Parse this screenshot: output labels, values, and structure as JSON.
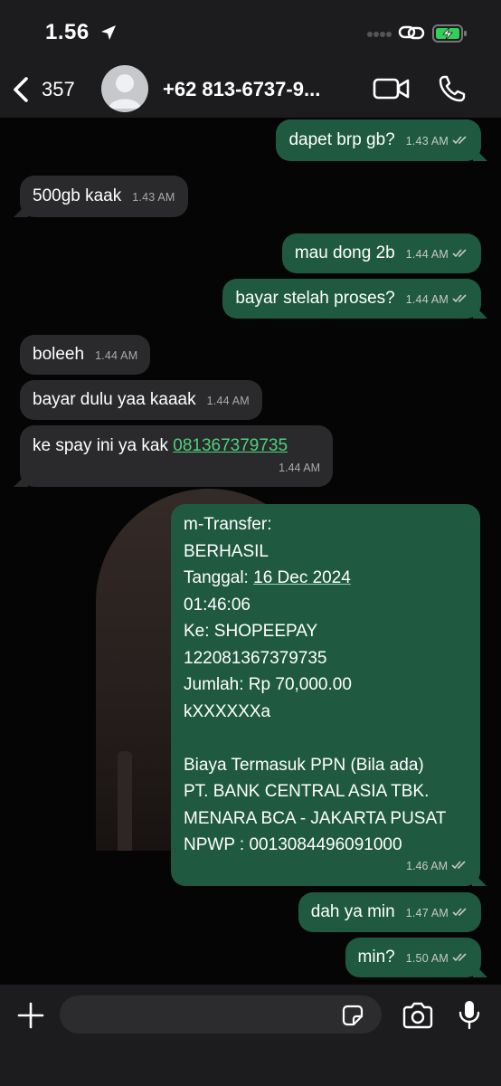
{
  "status": {
    "time": "1.56",
    "icons": [
      "location-arrow-icon",
      "signal-dots-icon",
      "link-icon",
      "battery-charging-icon"
    ],
    "battery_color": "#30d158"
  },
  "header": {
    "back_count": "357",
    "contact": "+62 813-6737-9...",
    "icons": [
      "chevron-left-icon",
      "avatar-placeholder",
      "video-call-icon",
      "phone-icon"
    ]
  },
  "messages": [
    {
      "dir": "out",
      "text": "dapet brp gb?",
      "time": "1.43 AM"
    },
    {
      "dir": "in",
      "text": "500gb kaak",
      "time": "1.43 AM"
    },
    {
      "dir": "out",
      "text": "mau dong 2b",
      "time": "1.44 AM"
    },
    {
      "dir": "out",
      "text": "bayar stelah proses?",
      "time": "1.44 AM"
    },
    {
      "dir": "in",
      "text": "boleeh",
      "time": "1.44 AM"
    },
    {
      "dir": "in",
      "text": "bayar dulu yaa kaaak",
      "time": "1.44 AM"
    },
    {
      "dir": "in",
      "text": "ke spay ini ya kak ",
      "link": "081367379735",
      "time": "1.44 AM"
    },
    {
      "dir": "out",
      "lines": [
        "m-Transfer:",
        "BERHASIL",
        "Tanggal: ",
        "01:46:06",
        "Ke: SHOPEEPAY",
        "122081367379735",
        "Jumlah: Rp 70,000.00",
        "kXXXXXXa",
        "",
        "Biaya Termasuk PPN (Bila ada)",
        "PT. BANK CENTRAL ASIA TBK.",
        "MENARA BCA - JAKARTA PUSAT",
        "NPWP : 0013084496091000"
      ],
      "date_value": "16 Dec 2024",
      "time": "1.46 AM"
    },
    {
      "dir": "out",
      "text": "dah ya min",
      "time": "1.47 AM"
    },
    {
      "dir": "out",
      "text": "min?",
      "time": "1.50 AM"
    }
  ],
  "composer": {
    "placeholder": "",
    "icons": [
      "plus-icon",
      "sticker-icon",
      "camera-icon",
      "microphone-icon"
    ]
  },
  "colors": {
    "outgoing_bubble": "#1f5a40",
    "incoming_bubble": "#2a2a2c",
    "link": "#4cd37a",
    "bar_background": "#1c1c1e"
  }
}
